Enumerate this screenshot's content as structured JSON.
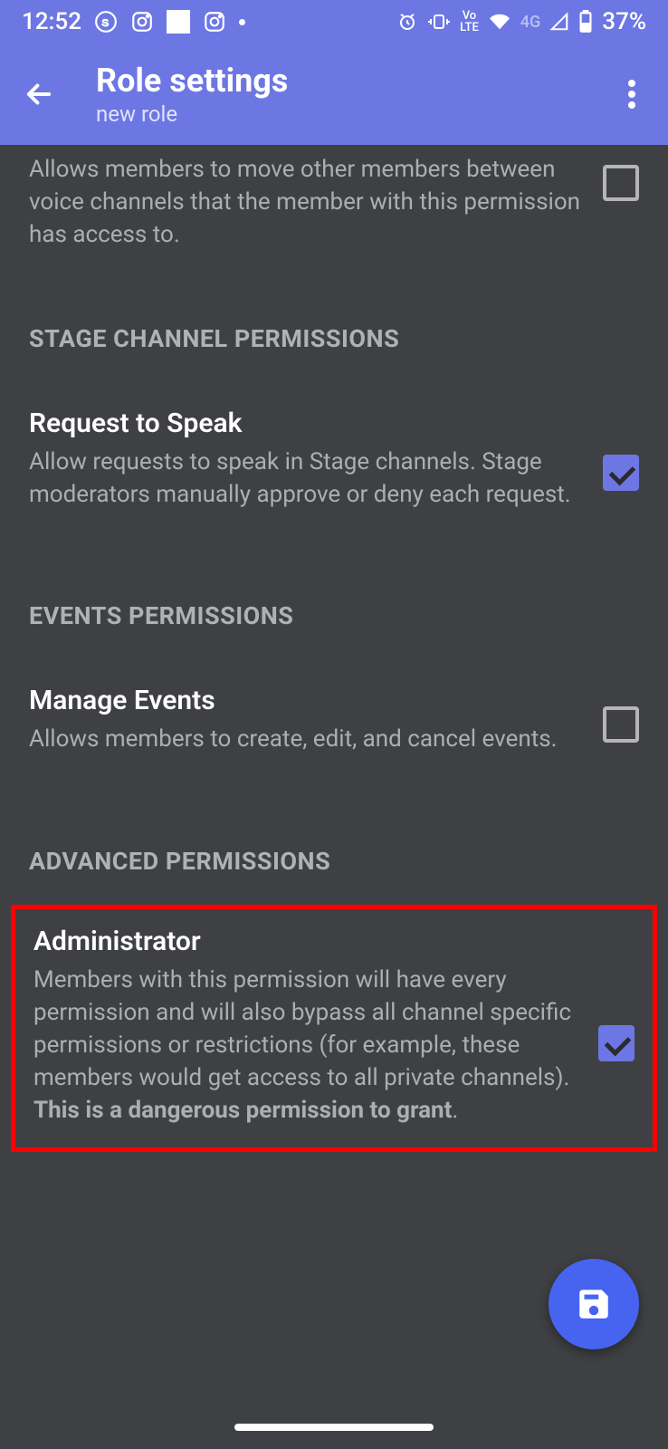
{
  "status": {
    "time": "12:52",
    "network_label": "4G",
    "volte_label": "Vo LTE",
    "battery": "37%"
  },
  "header": {
    "title": "Role settings",
    "subtitle": "new role"
  },
  "partial_permission": {
    "desc": "Allows members to move other members between voice channels that the member with this permission has access to.",
    "checked": false
  },
  "sections": [
    {
      "label": "STAGE CHANNEL PERMISSIONS",
      "items": [
        {
          "title": "Request to Speak",
          "desc": "Allow requests to speak in Stage channels. Stage moderators manually approve or deny each request.",
          "checked": true
        }
      ]
    },
    {
      "label": "EVENTS PERMISSIONS",
      "items": [
        {
          "title": "Manage Events",
          "desc": "Allows members to create, edit, and cancel events.",
          "checked": false
        }
      ]
    },
    {
      "label": "ADVANCED PERMISSIONS",
      "items": [
        {
          "title": "Administrator",
          "desc_plain": "Members with this permission will have every permission and will also bypass all channel specific permissions or restrictions (for example, these members would get access to all private channels). ",
          "desc_bold": "This is a dangerous permission to grant",
          "desc_tail": ".",
          "checked": true,
          "highlighted": true
        }
      ]
    }
  ]
}
